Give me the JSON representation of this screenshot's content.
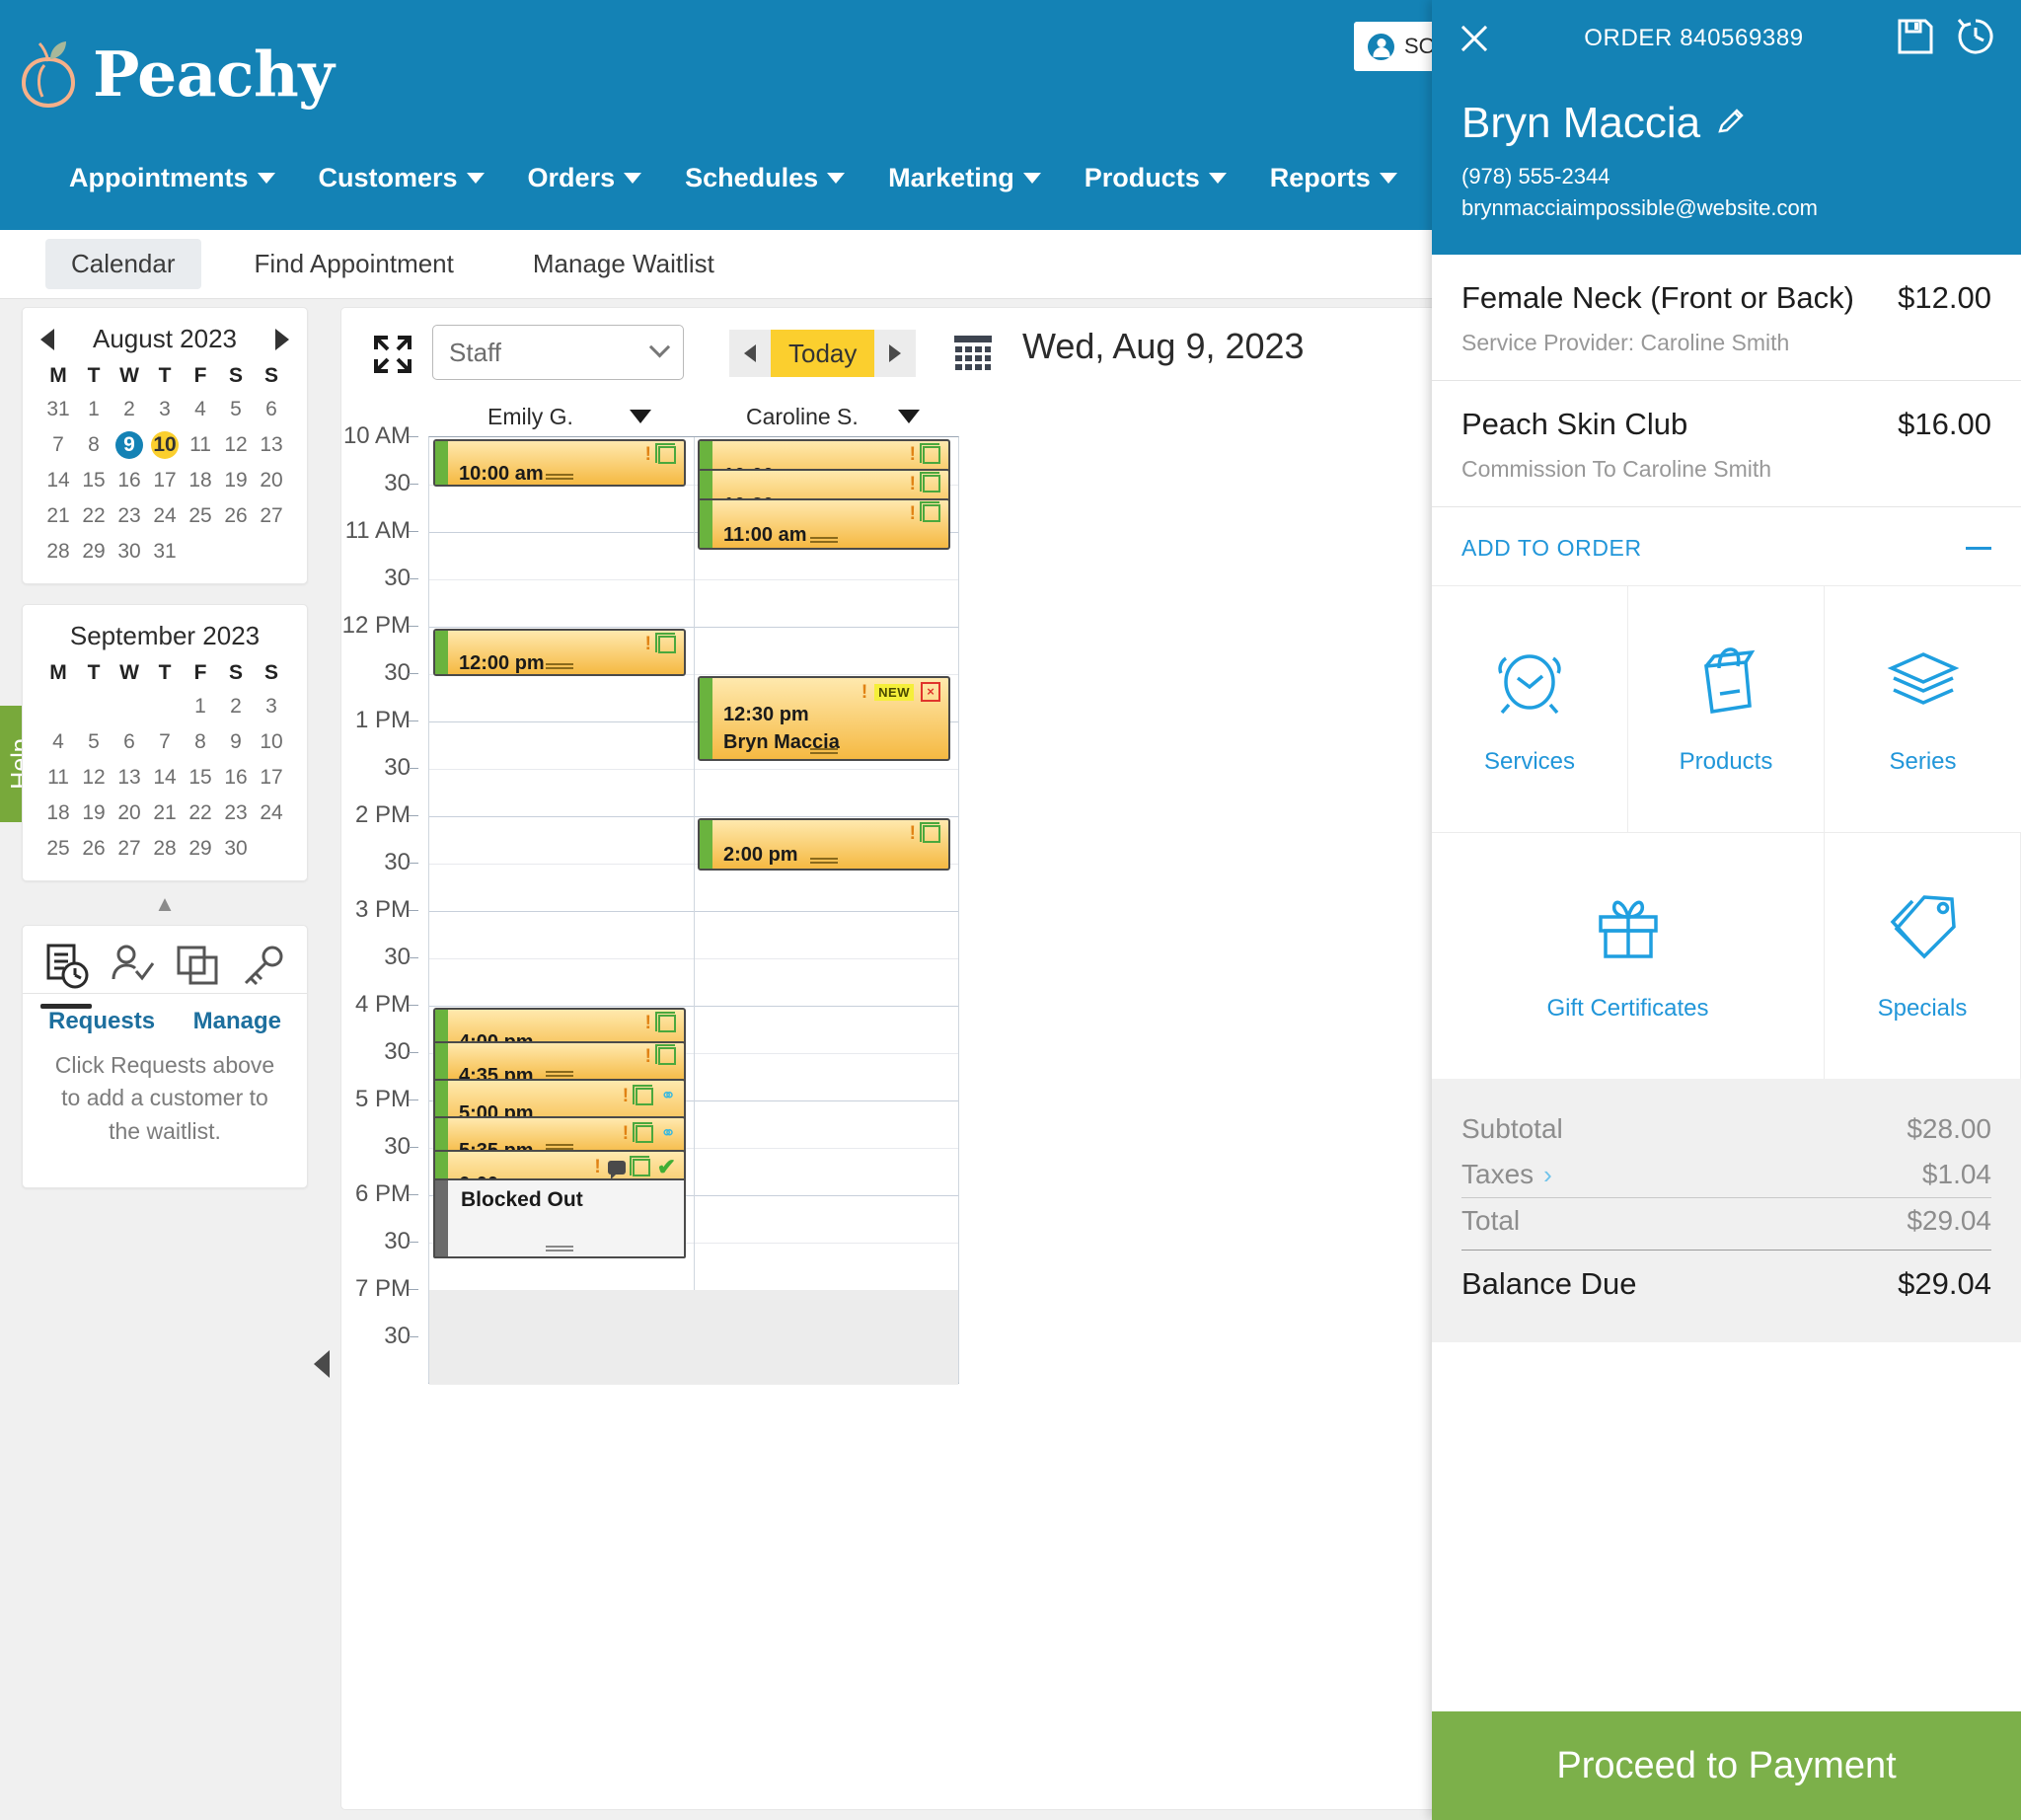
{
  "brand": {
    "name": "Peachy",
    "logo_icon": "peach-icon"
  },
  "account": {
    "label": "SO",
    "avatar_icon": "user-avatar-icon"
  },
  "mainnav": [
    {
      "label": "Appointments"
    },
    {
      "label": "Customers"
    },
    {
      "label": "Orders"
    },
    {
      "label": "Schedules"
    },
    {
      "label": "Marketing"
    },
    {
      "label": "Products"
    },
    {
      "label": "Reports"
    }
  ],
  "subtabs": [
    {
      "label": "Calendar",
      "active": true
    },
    {
      "label": "Find Appointment",
      "active": false
    },
    {
      "label": "Manage Waitlist",
      "active": false
    }
  ],
  "sidebar": {
    "help_tab": "Help",
    "minicals": [
      {
        "title": "August 2023",
        "dow": [
          "M",
          "T",
          "W",
          "T",
          "F",
          "S",
          "S"
        ],
        "weeks": [
          [
            "31",
            "1",
            "2",
            "3",
            "4",
            "5",
            "6"
          ],
          [
            "7",
            "8",
            "9",
            "10",
            "11",
            "12",
            "13"
          ],
          [
            "14",
            "15",
            "16",
            "17",
            "18",
            "19",
            "20"
          ],
          [
            "21",
            "22",
            "23",
            "24",
            "25",
            "26",
            "27"
          ],
          [
            "28",
            "29",
            "30",
            "31",
            "",
            "",
            ""
          ]
        ],
        "selected": "9",
        "highlighted": "10"
      },
      {
        "title": "September 2023",
        "dow": [
          "M",
          "T",
          "W",
          "T",
          "F",
          "S",
          "S"
        ],
        "weeks": [
          [
            "",
            "",
            "",
            "",
            "1",
            "2",
            "3"
          ],
          [
            "4",
            "5",
            "6",
            "7",
            "8",
            "9",
            "10"
          ],
          [
            "11",
            "12",
            "13",
            "14",
            "15",
            "16",
            "17"
          ],
          [
            "18",
            "19",
            "20",
            "21",
            "22",
            "23",
            "24"
          ],
          [
            "25",
            "26",
            "27",
            "28",
            "29",
            "30",
            ""
          ]
        ],
        "selected": "",
        "highlighted": ""
      }
    ],
    "waitlist": {
      "tabs": [
        {
          "icon": "requests-document-clock-icon",
          "active": true
        },
        {
          "icon": "person-check-icon",
          "active": false
        },
        {
          "icon": "copy-duplicate-icon",
          "active": false
        },
        {
          "icon": "key-icon",
          "active": false
        }
      ],
      "links": [
        {
          "label": "Requests"
        },
        {
          "label": "Manage"
        }
      ],
      "message": "Click Requests above to add a customer to the waitlist."
    }
  },
  "calendar": {
    "expand_icon": "expand-fullscreen-icon",
    "staff_select": {
      "value": "Staff",
      "chevron_icon": "chevron-down-icon"
    },
    "nav": {
      "prev_icon": "prev-arrow-icon",
      "today_label": "Today",
      "next_icon": "next-arrow-icon"
    },
    "datepicker_icon": "calendar-picker-icon",
    "date_title": "Wed, Aug 9, 2023",
    "columns": [
      {
        "name": "Emily G."
      },
      {
        "name": "Caroline S."
      }
    ],
    "time_labels": [
      "10 AM",
      "30",
      "11 AM",
      "30",
      "12 PM",
      "30",
      "1 PM",
      "30",
      "2 PM",
      "30",
      "3 PM",
      "30",
      "4 PM",
      "30",
      "5 PM",
      "30",
      "6 PM",
      "30",
      "7 PM",
      "30"
    ],
    "appointments": [
      {
        "col": 0,
        "start": "10:00 am",
        "name": "",
        "slots": 0.5,
        "offset": 0.0,
        "icons": [
          "exclamation",
          "copy"
        ],
        "short": true
      },
      {
        "col": 0,
        "start": "12:00 pm",
        "name": "",
        "slots": 0.5,
        "offset": 4.0,
        "icons": [
          "exclamation",
          "copy"
        ],
        "short": true
      },
      {
        "col": 0,
        "start": "4:00 pm",
        "name": "",
        "slots": 0.55,
        "offset": 12.0,
        "icons": [
          "exclamation",
          "copy"
        ],
        "short": true
      },
      {
        "col": 0,
        "start": "4:35 pm",
        "name": "",
        "slots": 0.45,
        "offset": 12.7,
        "icons": [
          "exclamation",
          "copy"
        ],
        "short": true
      },
      {
        "col": 0,
        "start": "5:00 pm",
        "name": "",
        "slots": 0.6,
        "offset": 13.5,
        "icons": [
          "exclamation",
          "copy",
          "link"
        ],
        "short": true
      },
      {
        "col": 0,
        "start": "5:35 pm",
        "name": "",
        "slots": 0.42,
        "offset": 14.3,
        "icons": [
          "exclamation",
          "copy",
          "link"
        ],
        "short": true
      },
      {
        "col": 0,
        "start": "6:00 pm",
        "name": "",
        "slots": 0.62,
        "offset": 15.0,
        "icons": [
          "exclamation",
          "chat",
          "copy",
          "check"
        ],
        "short": true
      },
      {
        "col": 1,
        "start": "10:00 am",
        "name": "",
        "slots": 0.55,
        "offset": 0.0,
        "icons": [
          "exclamation",
          "copy"
        ],
        "short": false
      },
      {
        "col": 1,
        "start": "10:30 am",
        "name": "",
        "slots": 0.55,
        "offset": 0.62,
        "icons": [
          "exclamation",
          "copy"
        ],
        "short": false
      },
      {
        "col": 1,
        "start": "11:00 am",
        "name": "",
        "slots": 0.55,
        "offset": 1.24,
        "icons": [
          "exclamation",
          "copy"
        ],
        "short": false
      },
      {
        "col": 1,
        "start": "12:30 pm",
        "name": "Bryn Maccia",
        "slots": 0.9,
        "offset": 5.0,
        "icons": [
          "exclamation",
          "new",
          "redx"
        ],
        "short": false
      },
      {
        "col": 1,
        "start": "2:00 pm",
        "name": "",
        "slots": 0.55,
        "offset": 8.0,
        "icons": [
          "exclamation",
          "copy"
        ],
        "short": false
      }
    ],
    "blocked": {
      "col": 0,
      "label": "Blocked Out",
      "offset": 15.6,
      "slots": 0.85
    }
  },
  "order": {
    "close_icon": "close-icon",
    "order_number": "ORDER 840569389",
    "save_icon": "save-floppy-icon",
    "history_icon": "history-clock-icon",
    "customer": {
      "name": "Bryn Maccia",
      "edit_icon": "edit-pencil-icon",
      "phone": "(978) 555-2344",
      "email": "brynmacciaimpossible@website.com"
    },
    "lines": [
      {
        "name": "Female Neck (Front or Back)",
        "price": "$12.00",
        "sub": "Service Provider: Caroline Smith"
      },
      {
        "name": "Peach Skin Club",
        "price": "$16.00",
        "sub": "Commission To Caroline Smith"
      }
    ],
    "add_to_order": {
      "label": "ADD TO ORDER",
      "collapse_icon": "minus-icon"
    },
    "add_options": [
      {
        "label": "Services",
        "icon": "alarm-clock-icon"
      },
      {
        "label": "Products",
        "icon": "shopping-bag-icon"
      },
      {
        "label": "Series",
        "icon": "layers-icon"
      },
      {
        "label": "Gift Certificates",
        "icon": "gift-box-icon"
      },
      {
        "label": "Specials",
        "icon": "price-tags-icon"
      }
    ],
    "totals": [
      {
        "label": "Subtotal",
        "value": "$28.00",
        "chevron": false,
        "bold": false
      },
      {
        "label": "Taxes",
        "value": "$1.04",
        "chevron": true,
        "bold": false
      },
      {
        "label": "Total",
        "value": "$29.04",
        "chevron": false,
        "bold": false,
        "rule": true
      },
      {
        "label": "Balance Due",
        "value": "$29.04",
        "chevron": false,
        "bold": true
      }
    ],
    "pay_button": "Proceed to Payment"
  },
  "colors": {
    "brand_blue": "#1482b5",
    "accent_yellow": "#fbcf2e",
    "green_pay": "#7cb04a",
    "link_blue": "#2196d9"
  }
}
